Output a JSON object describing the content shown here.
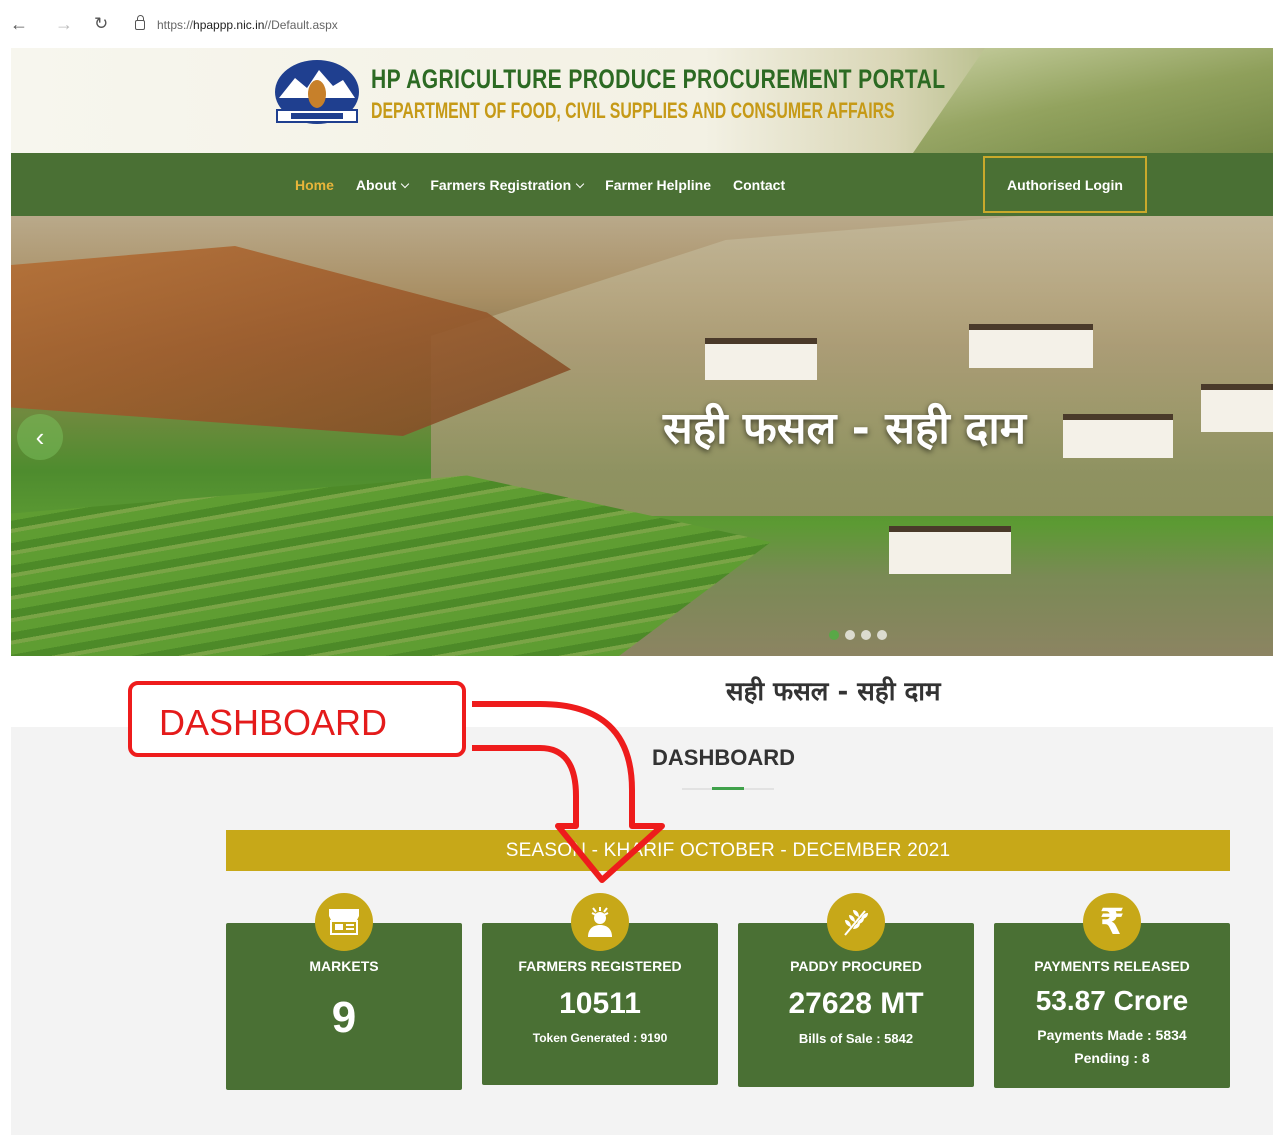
{
  "browser": {
    "url_prefix": "https://",
    "url_host": "hpappp.nic.in",
    "url_path": "//Default.aspx"
  },
  "header": {
    "title": "HP AGRICULTURE PRODUCE PROCUREMENT PORTAL",
    "subtitle": "DEPARTMENT OF FOOD, CIVIL SUPPLIES AND CONSUMER AFFAIRS"
  },
  "nav": {
    "items": [
      {
        "label": "Home",
        "active": true,
        "dropdown": false
      },
      {
        "label": "About",
        "active": false,
        "dropdown": true
      },
      {
        "label": "Farmers Registration",
        "active": false,
        "dropdown": true
      },
      {
        "label": "Farmer Helpline",
        "active": false,
        "dropdown": false
      },
      {
        "label": "Contact",
        "active": false,
        "dropdown": false
      }
    ],
    "login_label": "Authorised Login"
  },
  "hero": {
    "caption": "सही फसल - सही दाम",
    "slide_count": 4,
    "active_slide": 1
  },
  "tagline": "सही फसल - सही दाम",
  "dashboard": {
    "title": "DASHBOARD",
    "season": "SEASON - KHARIF OCTOBER - DECEMBER 2021",
    "cards": [
      {
        "label": "MARKETS",
        "value": "9",
        "sub1": "",
        "sub2": "",
        "icon": "market-icon"
      },
      {
        "label": "FARMERS REGISTERED",
        "value": "10511",
        "sub1": "Token Generated : 9190",
        "sub2": "",
        "icon": "farmer-icon"
      },
      {
        "label": "PADDY PROCURED",
        "value": "27628 MT",
        "sub1": "Bills of Sale : 5842",
        "sub2": "",
        "icon": "wheat-icon"
      },
      {
        "label": "PAYMENTS RELEASED",
        "value": "53.87 Crore",
        "sub1": "Payments Made : 5834",
        "sub2": "Pending : 8",
        "icon": "rupee-icon"
      }
    ]
  },
  "annotation": {
    "label": "DASHBOARD"
  },
  "colors": {
    "nav_green": "#4a7034",
    "gold": "#c7a818",
    "active_nav": "#e8b53a",
    "annotation_red": "#ee1c1c"
  }
}
